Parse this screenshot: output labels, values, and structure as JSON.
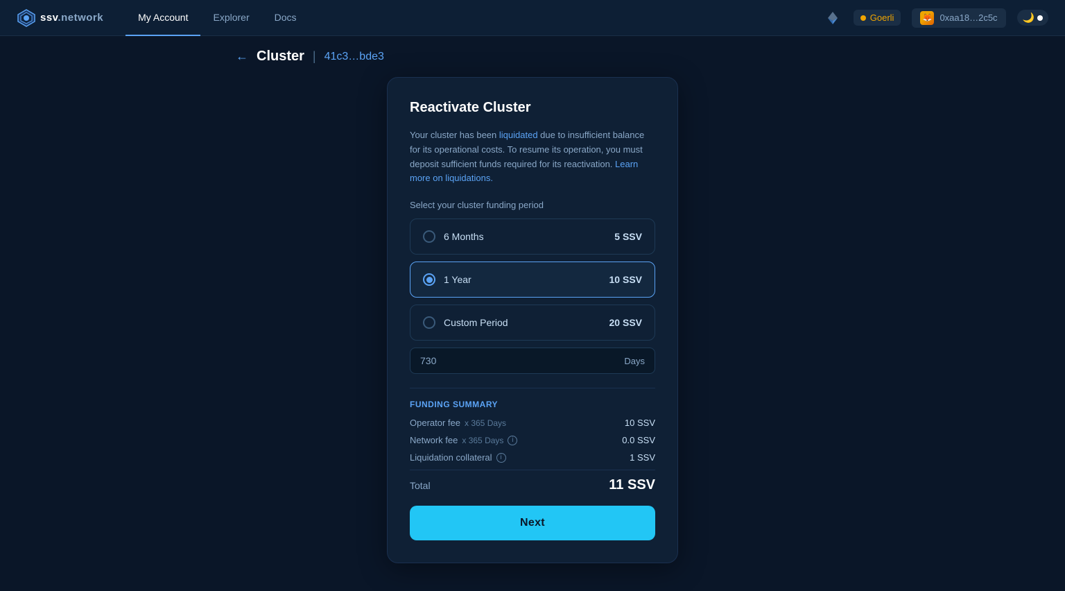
{
  "navbar": {
    "logo_text_ssv": "ssv",
    "logo_text_network": ".network",
    "links": [
      {
        "label": "My Account",
        "active": true
      },
      {
        "label": "Explorer",
        "active": false
      },
      {
        "label": "Docs",
        "active": false
      }
    ],
    "network_name": "Goerli",
    "wallet_address": "0xaa18…2c5c"
  },
  "breadcrumb": {
    "back_label": "←",
    "title": "Cluster",
    "separator": "|",
    "cluster_id": "41c3…bde3"
  },
  "card": {
    "title": "Reactivate Cluster",
    "description_start": "Your cluster has been ",
    "liquidated_link": "liquidated",
    "description_end": " due to insufficient balance for its operational costs. To resume its operation, you must deposit sufficient funds required for its reactivation. ",
    "learn_more_link": "Learn more on liquidations.",
    "period_section_label": "Select your cluster funding period",
    "periods": [
      {
        "id": "6months",
        "label": "6 Months",
        "value": "5 SSV",
        "selected": false
      },
      {
        "id": "1year",
        "label": "1 Year",
        "value": "10 SSV",
        "selected": true
      },
      {
        "id": "custom",
        "label": "Custom Period",
        "value": "20 SSV",
        "selected": false
      }
    ],
    "custom_input_value": "730",
    "custom_input_placeholder": "730",
    "days_label": "Days",
    "funding_summary": {
      "title": "Funding Summary",
      "rows": [
        {
          "label": "Operator fee",
          "tag": "x 365 Days",
          "value": "10 SSV",
          "has_info": false
        },
        {
          "label": "Network fee",
          "tag": "x 365 Days",
          "value": "0.0 SSV",
          "has_info": true
        },
        {
          "label": "Liquidation collateral",
          "tag": "",
          "value": "1 SSV",
          "has_info": true
        }
      ],
      "total_label": "Total",
      "total_value": "11 SSV"
    },
    "next_button_label": "Next"
  }
}
